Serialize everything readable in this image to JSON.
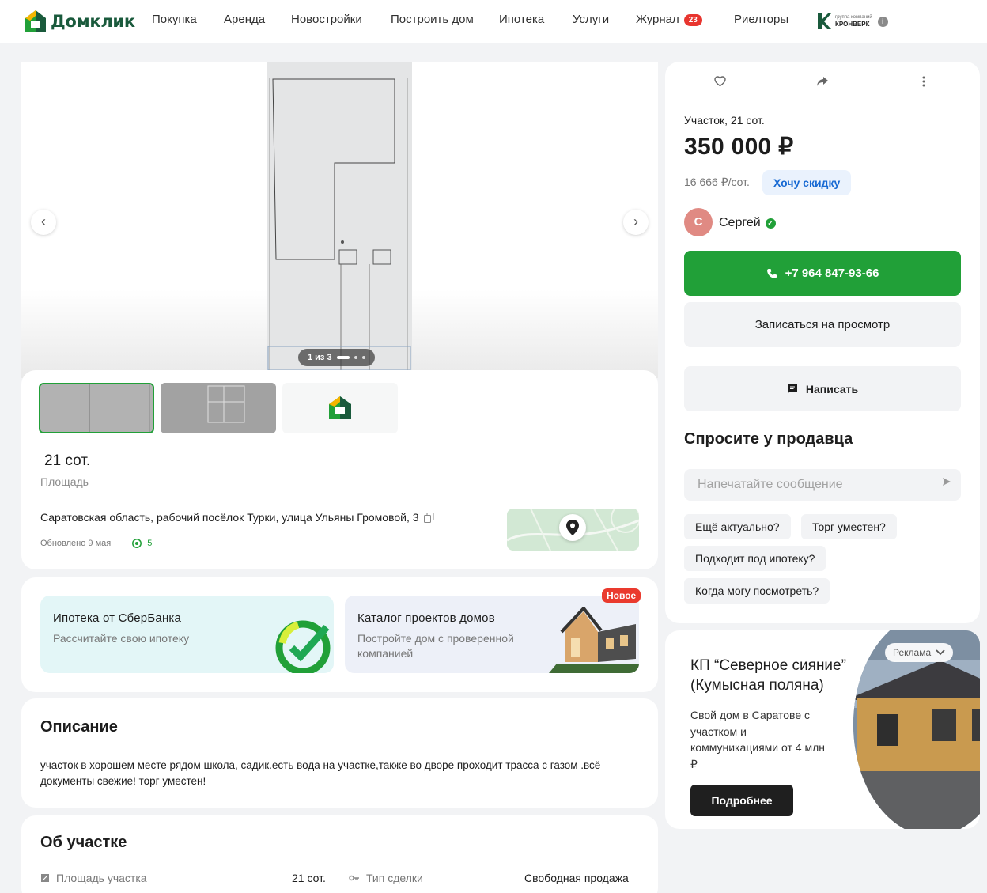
{
  "header": {
    "logo_text": "Домклик",
    "nav": [
      {
        "label": "Покупка"
      },
      {
        "label": "Аренда"
      },
      {
        "label": "Новостройки"
      },
      {
        "label": "Построить дом"
      },
      {
        "label": "Ипотека"
      },
      {
        "label": "Услуги"
      },
      {
        "label": "Журнал",
        "badge": "23"
      },
      {
        "label": "Риелторы"
      }
    ],
    "partner": {
      "small": "группа компаний",
      "name": "КРОНВЕРК",
      "info": "i"
    }
  },
  "gallery": {
    "counter": "1 из 3",
    "prev": "‹",
    "next": "›"
  },
  "listing": {
    "area_value": "21 сот.",
    "area_label": "Площадь",
    "address": "Саратовская область, рабочий посёлок Турки, улица Ульяны Громовой, 3",
    "updated": "Обновлено 9 мая",
    "views": "5"
  },
  "promos": {
    "sber_title": "Ипотека от СберБанка",
    "sber_sub": "Рассчитайте свою ипотеку",
    "catalog_title": "Каталог проектов домов",
    "catalog_sub": "Постройте дом с проверенной компанией",
    "new_badge": "Новое"
  },
  "description": {
    "title": "Описание",
    "text": "участок в хорошем месте рядом школа, садик.есть вода на участке,также во дворе проходит трасса с газом .всё документы свежие! торг уместен!"
  },
  "about": {
    "title": "Об участке",
    "area_label": "Площадь участка",
    "area_value": "21 сот.",
    "deal_label": "Тип сделки",
    "deal_value": "Свободная продажа"
  },
  "sidebar": {
    "listing_type": "Участок, 21 сот.",
    "price": "350 000 ₽",
    "price_per_unit": "16 666 ₽/сот.",
    "discount_button": "Хочу скидку",
    "seller_initial": "С",
    "seller_name": "Сергей",
    "phone": "+7 964 847-93-66",
    "view_button": "Записаться на просмотр",
    "write_button": "Написать",
    "ask_title": "Спросите у продавца",
    "message_placeholder": "Напечатайте сообщение",
    "chips": [
      "Ещё актуально?",
      "Торг уместен?",
      "Подходит под ипотеку?",
      "Когда могу посмотреть?"
    ]
  },
  "ad": {
    "title": "КП “Северное сияние” (Кумысная поляна)",
    "text": "Свой дом в Саратове с участком и коммуникациями от 4 млн ₽",
    "button": "Подробнее",
    "label": "Реклама"
  },
  "colors": {
    "brand_green": "#21a038",
    "logo_green": "#1a5a3c",
    "accent_blue": "#1769d3",
    "badge_red": "#e8352f"
  },
  "icons": [
    "logo-icon",
    "chevron-left-icon",
    "chevron-right-icon",
    "copy-icon",
    "eye-icon",
    "map-pin-icon",
    "heart-icon",
    "share-icon",
    "more-icon",
    "verified-icon",
    "phone-icon",
    "chat-icon",
    "send-icon",
    "chevron-down-icon",
    "area-icon",
    "key-icon"
  ]
}
